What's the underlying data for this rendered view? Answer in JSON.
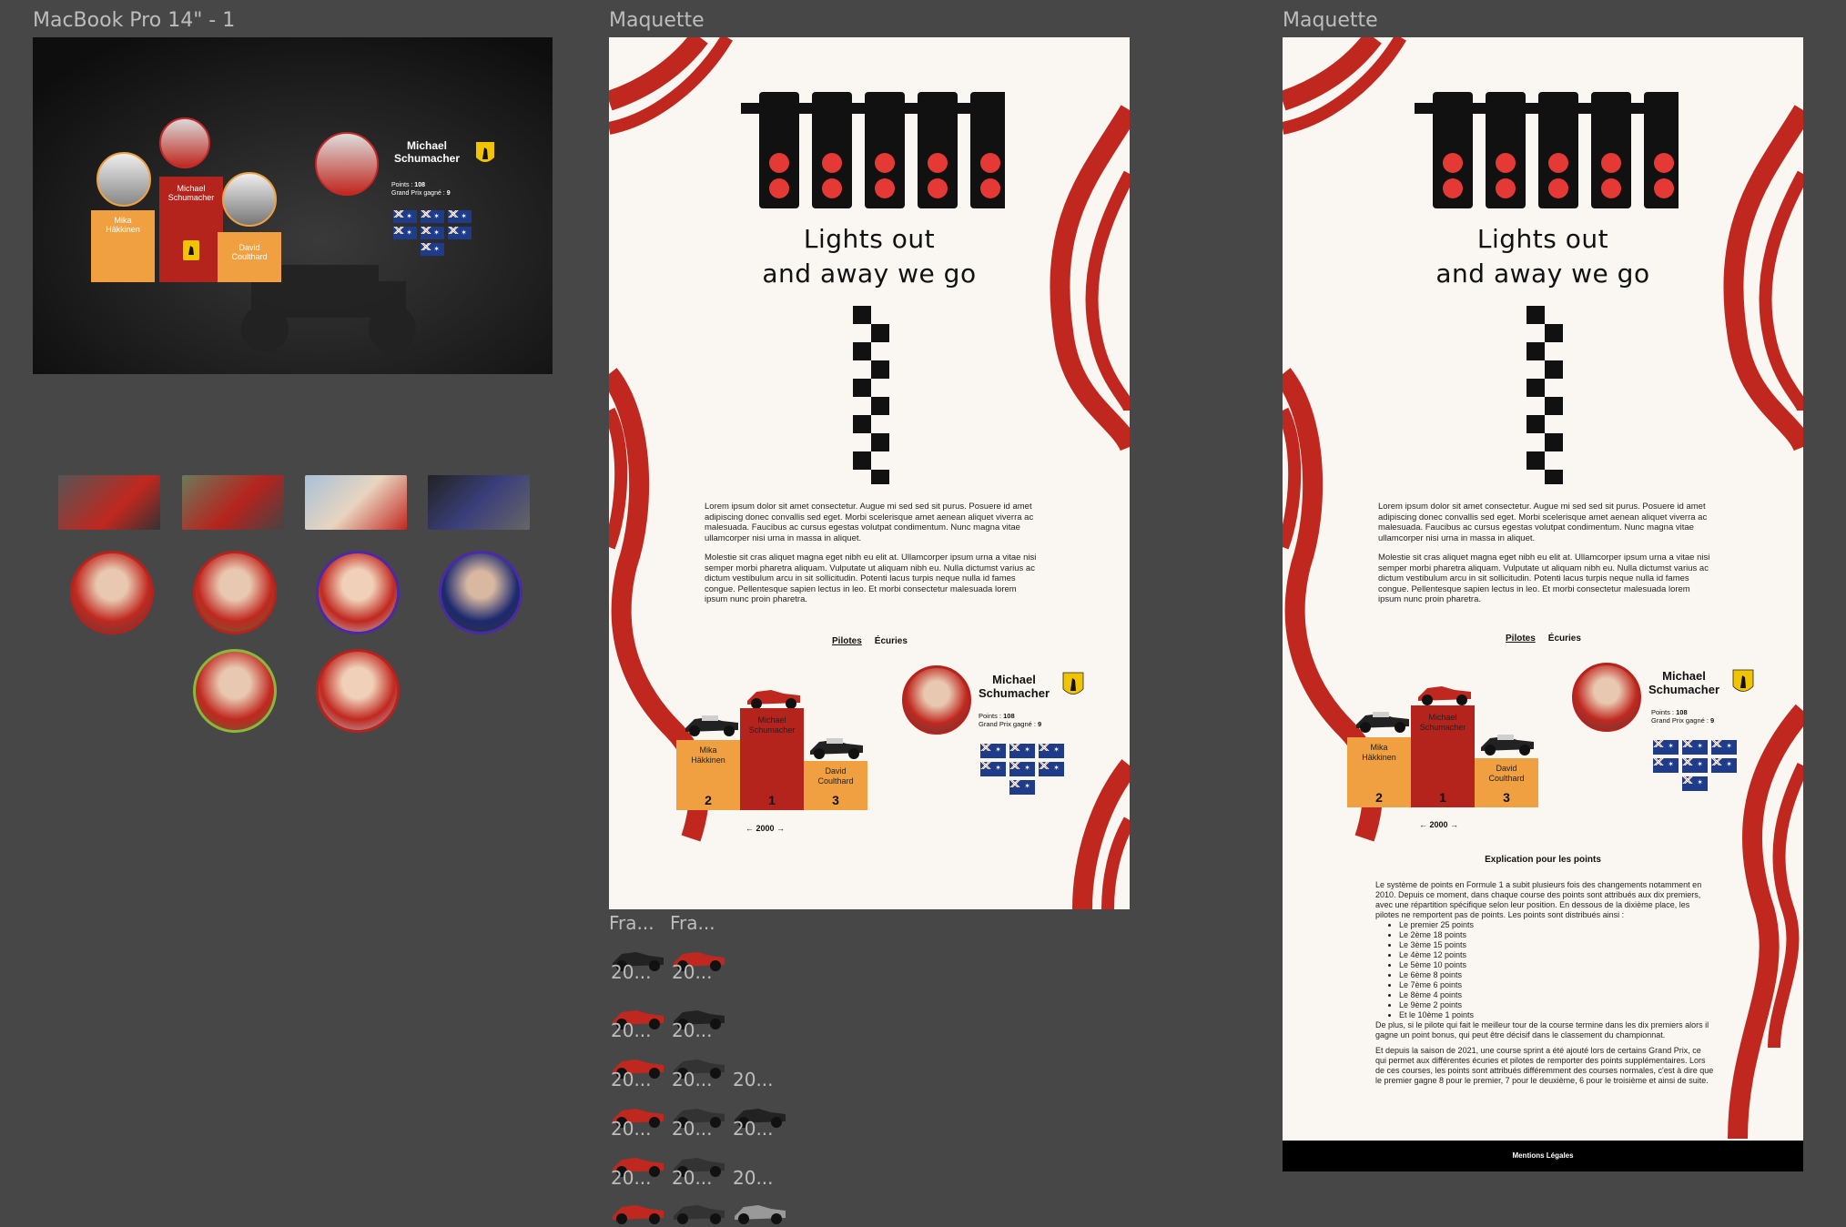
{
  "frames": {
    "macbook_label": "MacBook Pro 14\" - 1",
    "maquette_label_1": "Maquette",
    "maquette_label_2": "Maquette"
  },
  "hero": {
    "title_line1": "Lights out",
    "title_line2": "and away we go"
  },
  "lorem": {
    "p1": "Lorem ipsum dolor sit amet consectetur. Augue mi sed sed sit purus. Posuere id amet adipiscing donec convallis sed eget. Morbi scelerisque amet aenean aliquet viverra ac malesuada. Faucibus ac cursus egestas volutpat condimentum. Nunc magna vitae ullamcorper nisi urna in massa in aliquet.",
    "p2": "Molestie sit cras aliquet magna eget nibh eu elit at. Ullamcorper ipsum urna a vitae nisi semper morbi pharetra aliquam. Vulputate ut aliquam nibh eu. Nulla dictumst varius ac dictum vestibulum arcu in sit sollicitudin. Potenti lacus turpis neque nulla id fames congue. Pellentesque sapien lectus in leo. Et morbi consectetur malesuada lorem ipsum nunc proin pharetra."
  },
  "tabs": {
    "pilotes": "Pilotes",
    "ecuries": "Écuries"
  },
  "podium": {
    "first": {
      "name_line1": "Michael",
      "name_line2": "Schumacher",
      "rank": "1"
    },
    "second": {
      "name_line1": "Mika",
      "name_line2": "Häkkinen",
      "rank": "2"
    },
    "third": {
      "name_line1": "David",
      "name_line2": "Coulthard",
      "rank": "3"
    },
    "year_nav": "← 2000 →",
    "first_color": "#b5231d",
    "other_color": "#f0a040"
  },
  "driver_card": {
    "name_line1": "Michael",
    "name_line2": "Schumacher",
    "points_label": "Points : ",
    "points_value": "108",
    "gp_label": "Grand Prix gagné : ",
    "gp_value": "9"
  },
  "explication": {
    "title": "Explication pour les points",
    "intro": "Le système de points en Formule 1 a subit plusieurs fois des changements notamment en 2010. Depuis ce moment, dans chaque course des points sont attribués aux dix premiers, avec une répartition spécifique selon leur position. En dessous de la dixième place, les pilotes ne remportent pas de points. Les points sont distribués ainsi :",
    "items": [
      "Le premier 25 points",
      "Le 2ème 18 points",
      "Le 3ème 15 points",
      "Le 4ème 12 points",
      "Le 5ème 10 points",
      "Le 6ème 8 points",
      "Le 7ème 6 points",
      "Le 8ème 4 points",
      "Le 9ème 2 points",
      "Et le 10ème 1 points"
    ],
    "para2": "De plus, si le pilote qui fait le meilleur tour de la course termine dans les dix premiers alors il gagne un point bonus, qui peut être décisif dans le classement du championnat.",
    "para3": "Et depuis la saison de 2021, une course sprint a été ajouté lors de certains Grand Prix, ce qui permet aux différentes écuries et pilotes de remporter des points supplémentaires. Lors de ces courses, les points sont attribués différemment des courses normales, c'est à dire que le premier gagne 8 pour le premier, 7 pour le deuxième, 6 pour le troisième et ainsi de suite."
  },
  "footer": {
    "mentions": "Mentions Légales"
  },
  "small_frames": {
    "fra1": "Fra...",
    "fra2": "Fra...",
    "yr": "20..."
  },
  "colors": {
    "track_red": "#c0281f",
    "podium_orange": "#f0a040",
    "podium_red": "#b5231d",
    "canvas_bg": "#474747"
  }
}
